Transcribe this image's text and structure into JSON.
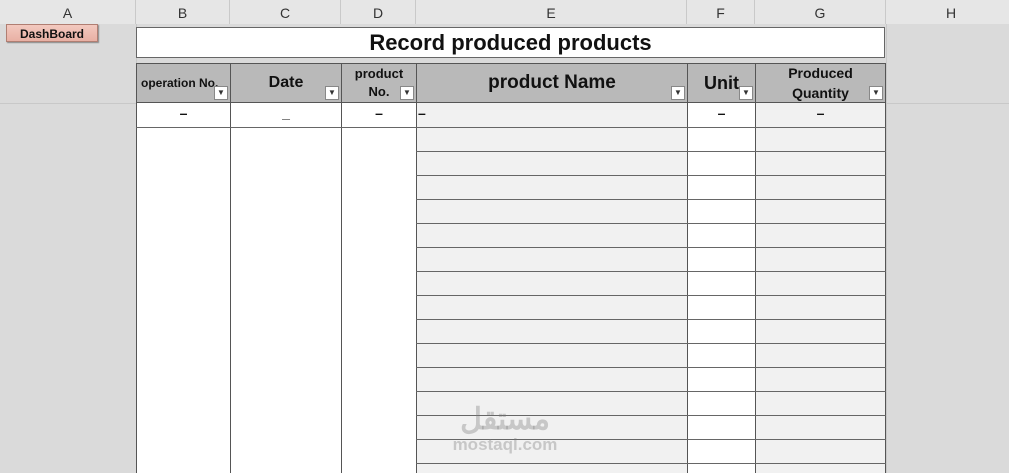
{
  "columns": [
    "A",
    "B",
    "C",
    "D",
    "E",
    "F",
    "G",
    "H"
  ],
  "dashboard_button": "DashBoard",
  "title": "Record produced products",
  "headers": {
    "operation_no": "operation No.",
    "date": "Date",
    "product_no_line1": "product",
    "product_no_line2": "No.",
    "product_name": "product Name",
    "unit": "Unit",
    "produced_qty_line1": "Produced",
    "produced_qty_line2": "Quantity"
  },
  "first_row": {
    "operation_no": "–",
    "date": "_",
    "product_no": "–",
    "product_name": "–",
    "unit": "–",
    "produced_qty": "–"
  },
  "watermark": {
    "logo": "مستقل",
    "url": "mostaql.com"
  }
}
